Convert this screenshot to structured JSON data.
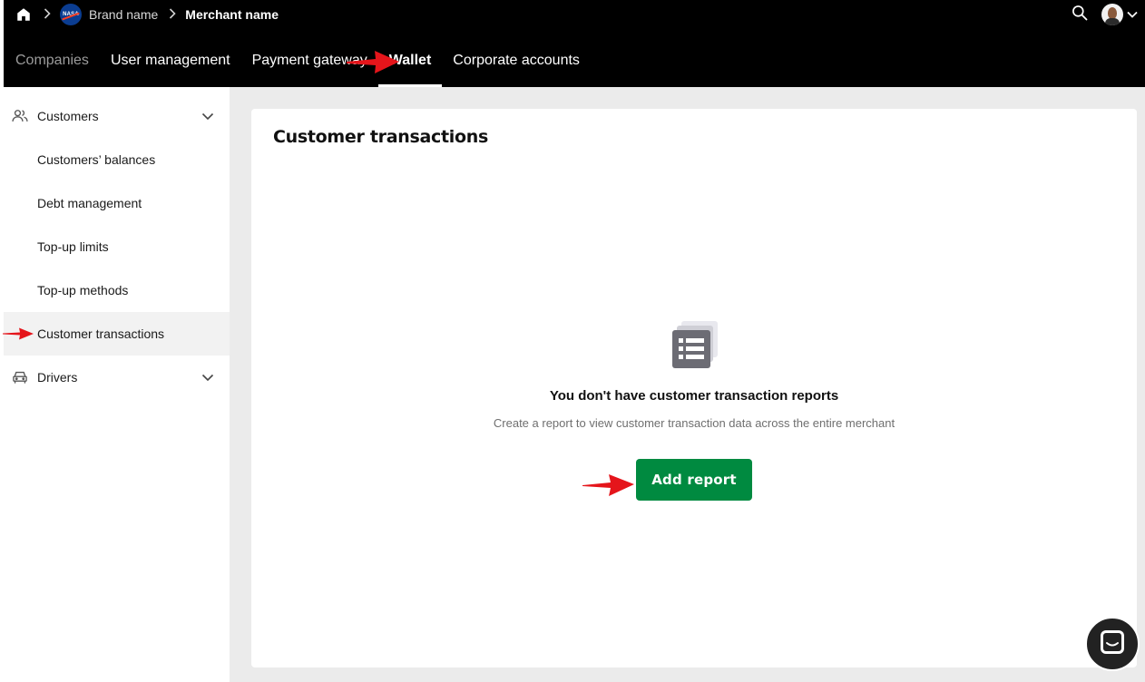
{
  "breadcrumb": {
    "brand_logo_text": "NASA",
    "brand_name": "Brand name",
    "merchant_name": "Merchant name"
  },
  "nav_tabs": [
    {
      "label": "Companies",
      "state": "disabled"
    },
    {
      "label": "User management",
      "state": "default"
    },
    {
      "label": "Payment gateway",
      "state": "default"
    },
    {
      "label": "Wallet",
      "state": "active"
    },
    {
      "label": "Corporate accounts",
      "state": "default"
    }
  ],
  "sidebar": {
    "groups": [
      {
        "label": "Customers",
        "icon": "users-icon",
        "expanded": true,
        "items": [
          {
            "label": "Customers’ balances"
          },
          {
            "label": "Debt management"
          },
          {
            "label": "Top-up limits"
          },
          {
            "label": "Top-up methods"
          },
          {
            "label": "Customer transactions",
            "active": true
          }
        ]
      },
      {
        "label": "Drivers",
        "icon": "car-icon",
        "expanded": false,
        "items": []
      }
    ]
  },
  "main": {
    "title": "Customer transactions",
    "empty_state": {
      "icon": "report-list-icon",
      "heading": "You don't have customer transaction reports",
      "description": "Create a report to view customer transaction data across the entire merchant",
      "button_label": "Add report"
    }
  },
  "annotations": {
    "arrow_color": "#e5151b",
    "arrows": [
      "tab-wallet",
      "sidebar-item-customer-transactions",
      "add-report-button"
    ]
  },
  "colors": {
    "topbar_bg": "#000000",
    "primary_button": "#008a40",
    "content_bg": "#ebebeb",
    "active_item_bg": "#f2f2f2"
  }
}
